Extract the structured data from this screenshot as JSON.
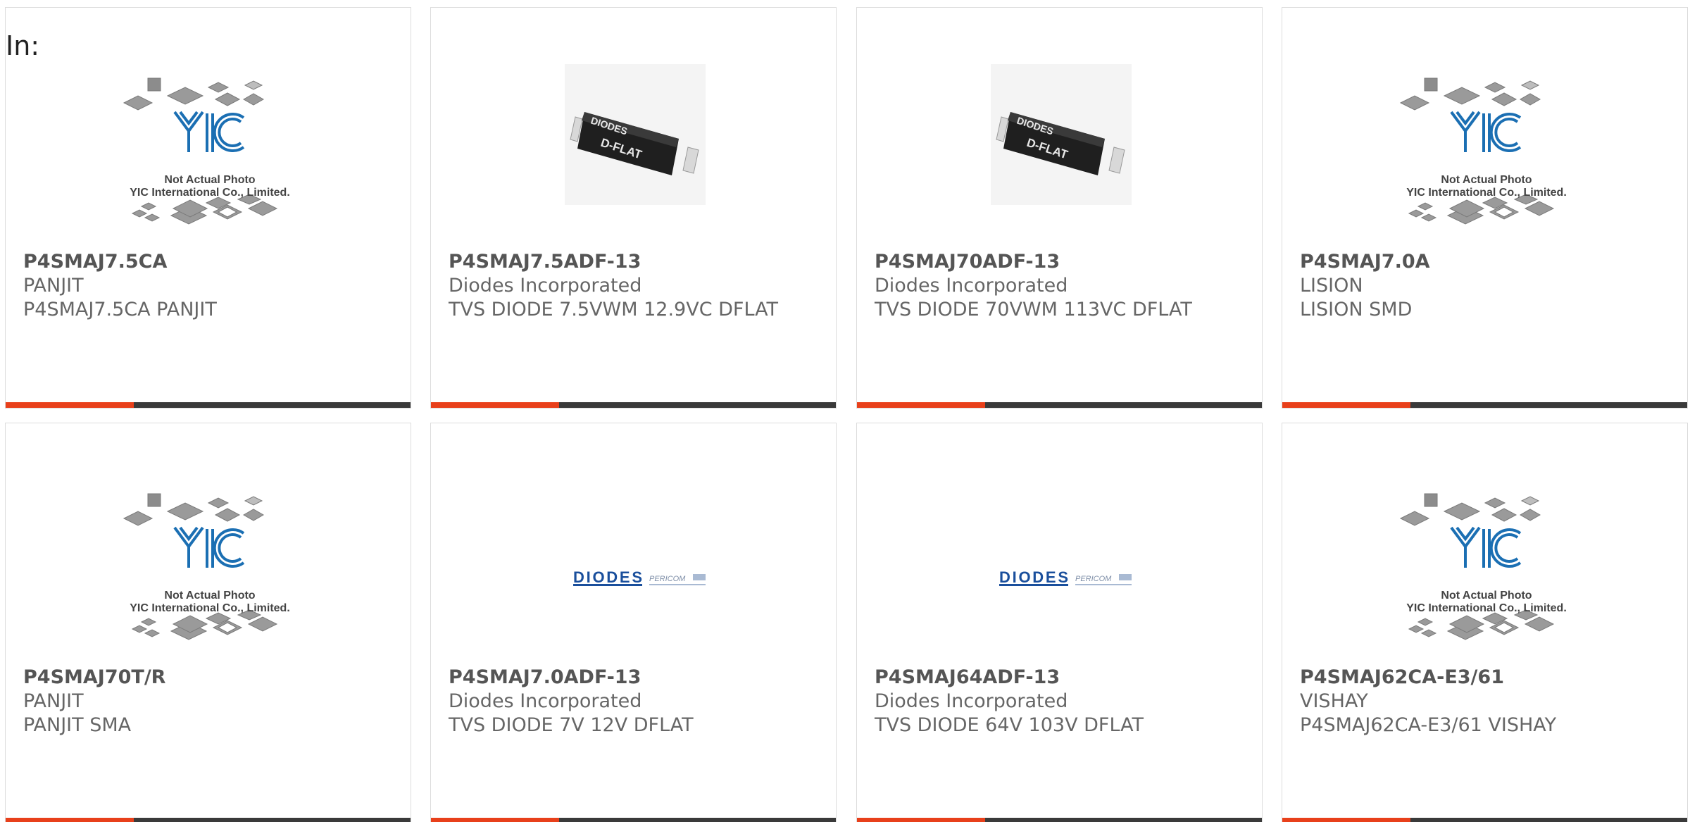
{
  "header": {
    "in_label": "In:"
  },
  "yic_placeholder": {
    "caption_line1": "Not Actual Photo",
    "caption_line2": "YIC International Co., Limited."
  },
  "chip_photo": {
    "brand": "DIODES",
    "package": "D-FLAT"
  },
  "diodes_logo": {
    "brand": "DIODES",
    "partner": "PERICOM"
  },
  "products": [
    {
      "part": "P4SMAJ7.5CA",
      "maker": "PANJIT",
      "desc": "P4SMAJ7.5CA PANJIT",
      "image": "yic-placeholder"
    },
    {
      "part": "P4SMAJ7.5ADF-13",
      "maker": "Diodes Incorporated",
      "desc": "TVS DIODE 7.5VWM 12.9VC DFLAT",
      "image": "dflat-chip"
    },
    {
      "part": "P4SMAJ70ADF-13",
      "maker": "Diodes Incorporated",
      "desc": "TVS DIODE 70VWM 113VC DFLAT",
      "image": "dflat-chip"
    },
    {
      "part": "P4SMAJ7.0A",
      "maker": "LISION",
      "desc": "LISION SMD",
      "image": "yic-placeholder"
    },
    {
      "part": "P4SMAJ70T/R",
      "maker": "PANJIT",
      "desc": "PANJIT SMA",
      "image": "yic-placeholder"
    },
    {
      "part": "P4SMAJ7.0ADF-13",
      "maker": "Diodes Incorporated",
      "desc": "TVS DIODE 7V 12V DFLAT",
      "image": "diodes-logo"
    },
    {
      "part": "P4SMAJ64ADF-13",
      "maker": "Diodes Incorporated",
      "desc": "TVS DIODE 64V 103V DFLAT",
      "image": "diodes-logo"
    },
    {
      "part": "P4SMAJ62CA-E3/61",
      "maker": "VISHAY",
      "desc": "P4SMAJ62CA-E3/61 VISHAY",
      "image": "yic-placeholder"
    }
  ],
  "colors": {
    "accent": "#e8401b",
    "bar": "#3a3a3a",
    "yic_blue": "#1b6fb3",
    "text": "#666666"
  }
}
